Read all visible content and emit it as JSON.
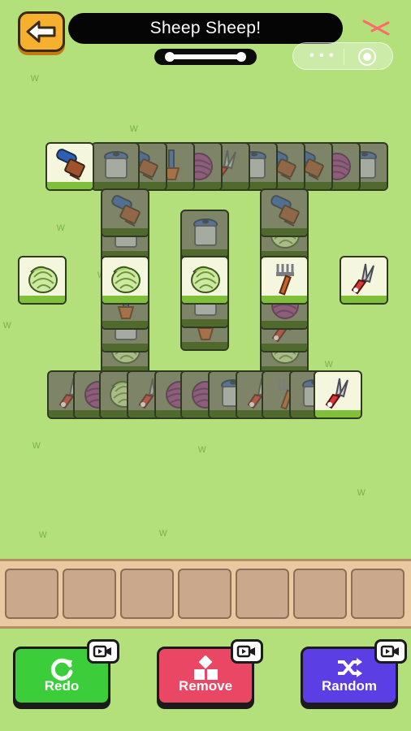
{
  "header": {
    "title": "Sheep Sheep!"
  },
  "actions": [
    {
      "label": "Redo",
      "color": "#3ccd3a",
      "icon": "refresh-icon"
    },
    {
      "label": "Remove",
      "color": "#e94764",
      "icon": "remove-shapes-icon"
    },
    {
      "label": "Random",
      "color": "#5b3ee4",
      "icon": "shuffle-icon"
    }
  ],
  "tray": {
    "slots": 7,
    "filled": 0
  },
  "colors": {
    "background": "#b3e07a",
    "tile_face": "#f4f7de",
    "tile_base": "#7fbf3a",
    "back_button": "#f6b02e"
  },
  "tile_types": [
    "brush",
    "pot",
    "yarn",
    "shears",
    "fork",
    "cabbage",
    "shovel"
  ]
}
